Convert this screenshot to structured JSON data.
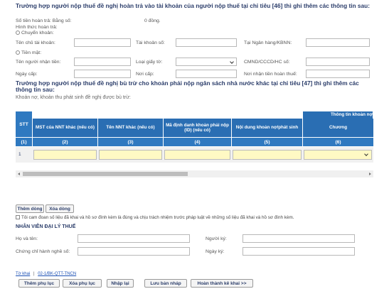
{
  "refund": {
    "heading": "Trường hợp người nộp thuế đề nghị hoàn trả vào tài khoản của người nộp thuế tại chỉ tiêu [46] thì ghi thêm các thông tin sau:",
    "amount_label": "Số tiền hoàn trả: Bằng số:",
    "amount_value": "0 đồng.",
    "method_label": "Hình thức hoàn trả:",
    "transfer_label": "Chuyển khoản:",
    "account_holder_label": "Tên chủ tài khoản:",
    "account_number_label": "Tài khoản số:",
    "bank_label": "Tại Ngân hàng/KBNN:",
    "cash_label": "Tiền mặt:",
    "receiver_name_label": "Tên người nhận tiền:",
    "id_type_label": "Loại giấy tờ:",
    "id_number_label": "CMND/CCCD/HC số:",
    "issue_date_label": "Ngày cấp:",
    "issue_place_label": "Nơi cấp:",
    "refund_place_label": "Nơi nhận tiền hoàn thuế:"
  },
  "offset": {
    "heading": "Trường hợp người nộp thuế đề nghị bù trừ cho khoản phải nộp ngân sách nhà nước khác tại chỉ tiêu [47] thì ghi thêm các thông tin sau:",
    "subheading": "Khoản nợ, khoản thu phát sinh đề nghị được bù trừ:",
    "table": {
      "group_header": "Thông tin khoản nợ",
      "headers": [
        "STT",
        "MST của NNT khác (nếu có)",
        "Tên NNT khác (nếu có)",
        "Mã định danh khoản phải nộp (ID) (nếu có)",
        "Nội dung khoản nợ/phát sinh",
        "Chương"
      ],
      "indices": [
        "(1)",
        "(2)",
        "(3)",
        "(4)",
        "(5)",
        "(6)"
      ],
      "rows": [
        {
          "stt": "1"
        }
      ]
    }
  },
  "row_buttons": {
    "add": "Thêm dòng",
    "delete": "Xóa dòng"
  },
  "commitment": "Tôi cam đoan số liệu đã khai và hồ sơ đính kèm là đúng và chịu trách nhiệm trước pháp luật về những số liệu đã khai và hồ sơ đính kèm.",
  "agent": {
    "heading": "NHÂN VIÊN ĐẠI LÝ THUẾ",
    "name_label": "Họ và tên:",
    "signer_label": "Người ký:",
    "cert_label": "Chứng chỉ hành nghề số:",
    "sign_date_label": "Ngày ký:"
  },
  "footer_links": {
    "link1": "Tờ khai",
    "separator": "|",
    "link2": "02-1/BK-QTT-TNCN"
  },
  "bottom_buttons": {
    "add_appendix": "Thêm phụ lục",
    "delete_appendix": "Xóa phụ lục",
    "reset": "Nhập lại",
    "save_draft": "Lưu bản nháp",
    "complete": "Hoàn thành kê khai >>"
  }
}
